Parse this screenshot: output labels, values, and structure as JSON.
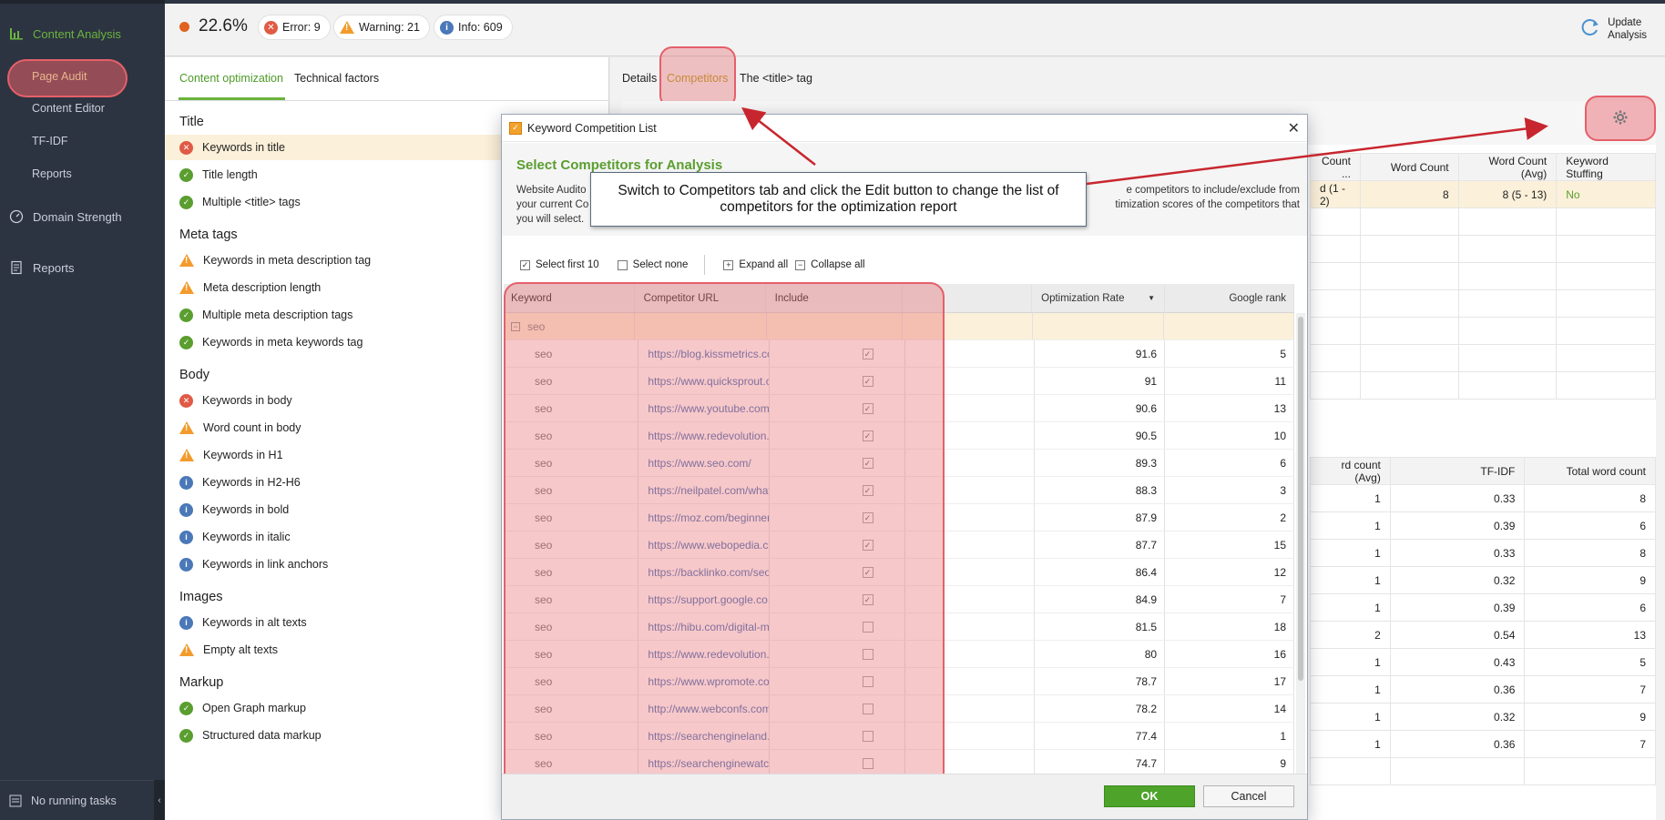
{
  "sidebar": {
    "content_analysis": "Content Analysis",
    "items": [
      "Page Audit",
      "Content Editor",
      "TF-IDF",
      "Reports"
    ],
    "domain_strength": "Domain Strength",
    "reports": "Reports",
    "bottom": "No running tasks",
    "collapse": "‹"
  },
  "topbar": {
    "score": "22.6%",
    "error": "Error: 9",
    "warning": "Warning: 21",
    "info": "Info: 609",
    "update_line1": "Update",
    "update_line2": "Analysis"
  },
  "left_tabs": [
    "Content optimization",
    "Technical factors"
  ],
  "sections": [
    {
      "title": "Title",
      "items": [
        {
          "label": "Keywords in title",
          "status": "err",
          "selected": true
        },
        {
          "label": "Title length",
          "status": "ok"
        },
        {
          "label": "Multiple <title> tags",
          "status": "ok"
        }
      ]
    },
    {
      "title": "Meta tags",
      "items": [
        {
          "label": "Keywords in meta description tag",
          "status": "warn"
        },
        {
          "label": "Meta description length",
          "status": "warn"
        },
        {
          "label": "Multiple meta description tags",
          "status": "ok"
        },
        {
          "label": "Keywords in meta keywords tag",
          "status": "ok"
        }
      ]
    },
    {
      "title": "Body",
      "items": [
        {
          "label": "Keywords in body",
          "status": "err"
        },
        {
          "label": "Word count in body",
          "status": "warn"
        },
        {
          "label": "Keywords in H1",
          "status": "warn"
        },
        {
          "label": "Keywords in H2-H6",
          "status": "info"
        },
        {
          "label": "Keywords in bold",
          "status": "info"
        },
        {
          "label": "Keywords in italic",
          "status": "info"
        },
        {
          "label": "Keywords in link anchors",
          "status": "info"
        }
      ]
    },
    {
      "title": "Images",
      "items": [
        {
          "label": "Keywords in alt texts",
          "status": "info"
        },
        {
          "label": "Empty alt texts",
          "status": "warn"
        }
      ]
    },
    {
      "title": "Markup",
      "items": [
        {
          "label": "Open Graph markup",
          "status": "ok"
        },
        {
          "label": "Structured data markup",
          "status": "ok"
        }
      ]
    }
  ],
  "right_tabs": [
    "Details",
    "Competitors",
    "The <title> tag"
  ],
  "bg_table1": {
    "headers": [
      "Count ...",
      "Word Count",
      "Word Count (Avg)",
      "Keyword Stuffing"
    ],
    "row": [
      "d (1 - 2)",
      "8",
      "8 (5 - 13)",
      "No"
    ]
  },
  "bg_table2": {
    "headers": [
      "rd count (Avg)",
      "TF-IDF",
      "Total word count"
    ],
    "rows": [
      [
        "1",
        "0.33",
        "8"
      ],
      [
        "1",
        "0.39",
        "6"
      ],
      [
        "1",
        "0.33",
        "8"
      ],
      [
        "1",
        "0.32",
        "9"
      ],
      [
        "1",
        "0.39",
        "6"
      ],
      [
        "2",
        "0.54",
        "13"
      ],
      [
        "1",
        "0.43",
        "5"
      ],
      [
        "1",
        "0.36",
        "7"
      ],
      [
        "1",
        "0.32",
        "9"
      ],
      [
        "1",
        "0.36",
        "7"
      ]
    ]
  },
  "modal": {
    "window_title": "Keyword Competition List",
    "heading": "Select Competitors for Analysis",
    "desc_left": "Website Audito",
    "desc_left2": "your current Co",
    "desc_left3": "you will select.",
    "desc_right": "e competitors to include/exclude from",
    "desc_right2": "timization scores of the competitors that",
    "toolbar": [
      "Select first 10",
      "Select none",
      "Expand all",
      "Collapse all"
    ],
    "columns": [
      "Keyword",
      "Competitor URL",
      "Include",
      "",
      "Optimization Rate",
      "Google rank"
    ],
    "group_keyword": "seo",
    "rows": [
      {
        "keyword": "seo",
        "url": "https://blog.kissmetrics.co...",
        "include": true,
        "rate": "91.6",
        "rank": "5"
      },
      {
        "keyword": "seo",
        "url": "https://www.quicksprout.c...",
        "include": true,
        "rate": "91",
        "rank": "11"
      },
      {
        "keyword": "seo",
        "url": "https://www.youtube.com/...",
        "include": true,
        "rate": "90.6",
        "rank": "13"
      },
      {
        "keyword": "seo",
        "url": "https://www.redevolution.c...",
        "include": true,
        "rate": "90.5",
        "rank": "10"
      },
      {
        "keyword": "seo",
        "url": "https://www.seo.com/",
        "include": true,
        "rate": "89.3",
        "rank": "6"
      },
      {
        "keyword": "seo",
        "url": "https://neilpatel.com/what-...",
        "include": true,
        "rate": "88.3",
        "rank": "3"
      },
      {
        "keyword": "seo",
        "url": "https://moz.com/beginner...",
        "include": true,
        "rate": "87.9",
        "rank": "2"
      },
      {
        "keyword": "seo",
        "url": "https://www.webopedia.co...",
        "include": true,
        "rate": "87.7",
        "rank": "15"
      },
      {
        "keyword": "seo",
        "url": "https://backlinko.com/seo-...",
        "include": true,
        "rate": "86.4",
        "rank": "12"
      },
      {
        "keyword": "seo",
        "url": "https://support.google.co...",
        "include": true,
        "rate": "84.9",
        "rank": "7"
      },
      {
        "keyword": "seo",
        "url": "https://hibu.com/digital-m...",
        "include": false,
        "rate": "81.5",
        "rank": "18"
      },
      {
        "keyword": "seo",
        "url": "https://www.redevolution.c...",
        "include": false,
        "rate": "80",
        "rank": "16"
      },
      {
        "keyword": "seo",
        "url": "https://www.wpromote.co...",
        "include": false,
        "rate": "78.7",
        "rank": "17"
      },
      {
        "keyword": "seo",
        "url": "http://www.webconfs.com/...",
        "include": false,
        "rate": "78.2",
        "rank": "14"
      },
      {
        "keyword": "seo",
        "url": "https://searchengineland....",
        "include": false,
        "rate": "77.4",
        "rank": "1"
      },
      {
        "keyword": "seo",
        "url": "https://searchenginewatch...",
        "include": false,
        "rate": "74.7",
        "rank": "9"
      }
    ],
    "ok": "OK",
    "cancel": "Cancel"
  },
  "callout": "Switch to Competitors tab and click the Edit button to change the list of competitors for the optimization report",
  "colors": {
    "accent": "#6ab43e",
    "sidebar": "#2d3441",
    "highlight": "#e4606a",
    "error": "#e05a45",
    "warning": "#f29b2c",
    "info": "#4a78b8"
  }
}
